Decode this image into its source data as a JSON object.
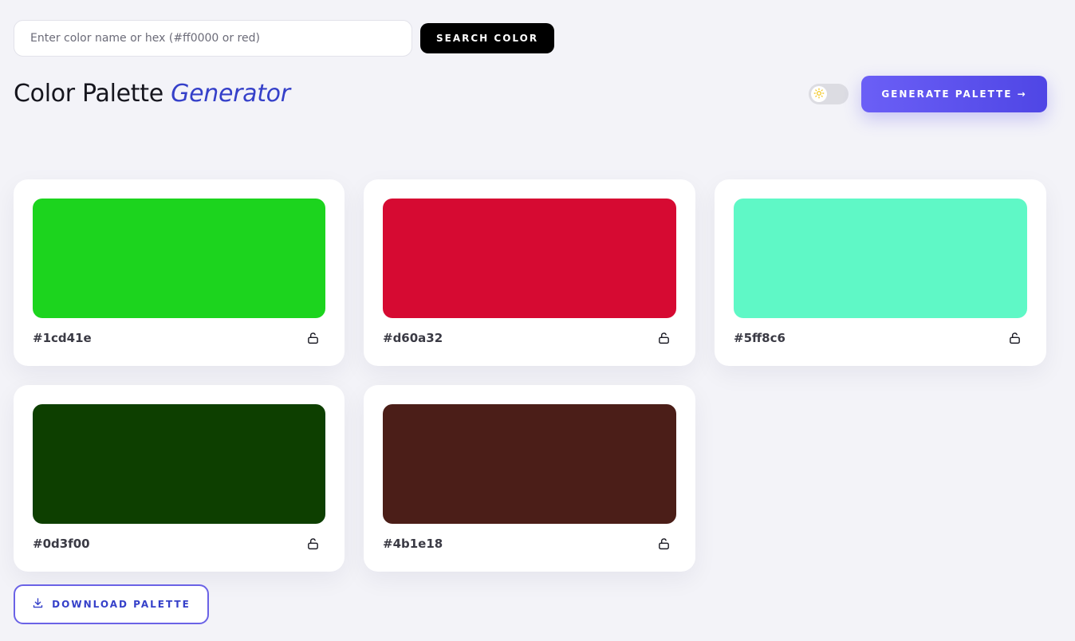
{
  "search": {
    "placeholder": "Enter color name or hex (#ff0000 or red)",
    "value": "",
    "button_label": "SEARCH COLOR"
  },
  "header": {
    "title_main": "Color Palette",
    "title_accent": "Generator"
  },
  "theme_toggle": {
    "icon": "sun-icon",
    "state": "light"
  },
  "generate_button": {
    "label": "GENERATE PALETTE →"
  },
  "palette": [
    {
      "hex": "#1cd41e",
      "color": "#1cd41e",
      "locked": false,
      "lock_icon": "unlock-icon"
    },
    {
      "hex": "#d60a32",
      "color": "#d60a32",
      "locked": false,
      "lock_icon": "unlock-icon"
    },
    {
      "hex": "#5ff8c6",
      "color": "#5ff8c6",
      "locked": false,
      "lock_icon": "unlock-icon"
    },
    {
      "hex": "#0d3f00",
      "color": "#0d3f00",
      "locked": false,
      "lock_icon": "unlock-icon"
    },
    {
      "hex": "#4b1e18",
      "color": "#4b1e18",
      "locked": false,
      "lock_icon": "unlock-icon"
    }
  ],
  "download_button": {
    "label": "DOWNLOAD PALETTE",
    "icon": "download-icon"
  },
  "colors": {
    "accent": "#3540c9",
    "primary_gradient_start": "#6b5ff6",
    "primary_gradient_end": "#4f46e5",
    "background": "#f3f3f8"
  }
}
